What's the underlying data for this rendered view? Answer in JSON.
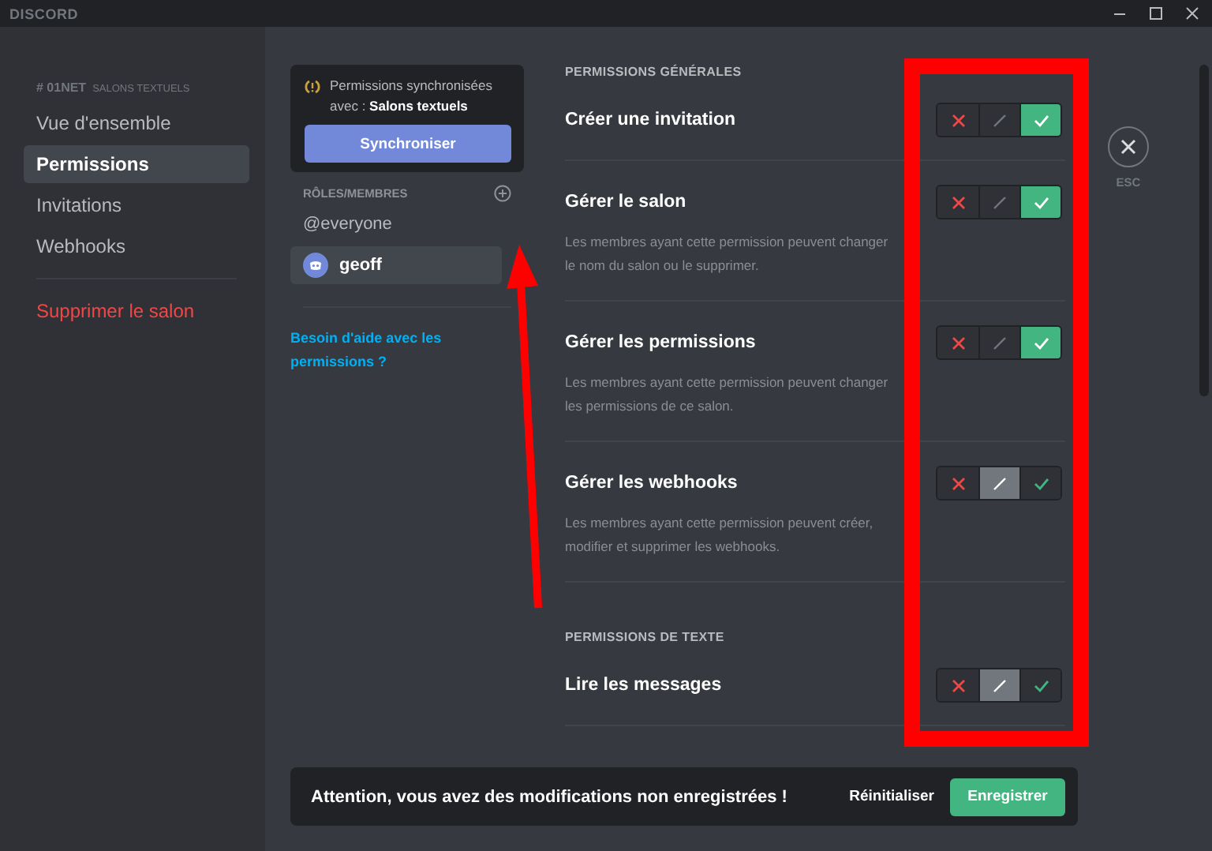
{
  "titlebar": {
    "logo": "DISCORD"
  },
  "sidebar": {
    "channel": "# 01NET",
    "category": "SALONS TEXTUELS",
    "items": [
      {
        "label": "Vue d'ensemble",
        "selected": false
      },
      {
        "label": "Permissions",
        "selected": true
      },
      {
        "label": "Invitations",
        "selected": false
      },
      {
        "label": "Webhooks",
        "selected": false
      }
    ],
    "danger_item": "Supprimer le salon"
  },
  "sync_card": {
    "text": "Permissions synchronisées avec : **Salons textuels**",
    "button": "Synchroniser"
  },
  "roles": {
    "heading": "RÔLES/MEMBRES",
    "items": [
      {
        "label": "@everyone",
        "kind": "role",
        "selected": false
      },
      {
        "label": "geoff",
        "kind": "member",
        "selected": true
      }
    ],
    "help_link": "Besoin d'aide avec les permissions ?"
  },
  "sections": [
    {
      "heading": "PERMISSIONS GÉNÉRALES",
      "permissions": [
        {
          "title": "Créer une invitation",
          "options": [
            {
              "kind": "deny",
              "selected": false
            },
            {
              "kind": "neutral",
              "selected": false
            },
            {
              "kind": "allow",
              "selected": true
            }
          ]
        },
        {
          "title": "Gérer le salon",
          "description": "Les membres ayant cette permission peuvent changer le nom du salon ou le supprimer.",
          "options": [
            {
              "kind": "deny",
              "selected": false
            },
            {
              "kind": "neutral",
              "selected": false
            },
            {
              "kind": "allow",
              "selected": true
            }
          ]
        },
        {
          "title": "Gérer les permissions",
          "description": "Les membres ayant cette permission peuvent changer les permissions de ce salon.",
          "options": [
            {
              "kind": "deny",
              "selected": false
            },
            {
              "kind": "neutral",
              "selected": false
            },
            {
              "kind": "allow",
              "selected": true
            }
          ]
        },
        {
          "title": "Gérer les webhooks",
          "description": "Les membres ayant cette permission peuvent créer, modifier et supprimer les webhooks.",
          "options": [
            {
              "kind": "deny",
              "selected": false
            },
            {
              "kind": "neutral",
              "selected": true
            },
            {
              "kind": "allow",
              "selected": false
            }
          ]
        }
      ]
    },
    {
      "heading": "PERMISSIONS DE TEXTE",
      "permissions": [
        {
          "title": "Lire les messages",
          "options": [
            {
              "kind": "deny",
              "selected": false
            },
            {
              "kind": "neutral",
              "selected": true
            },
            {
              "kind": "allow",
              "selected": false
            }
          ]
        }
      ]
    }
  ],
  "close": {
    "label": "ESC"
  },
  "notice": {
    "message": "Attention, vous avez des modifications non enregistrées !",
    "reset": "Réinitialiser",
    "save": "Enregistrer"
  }
}
